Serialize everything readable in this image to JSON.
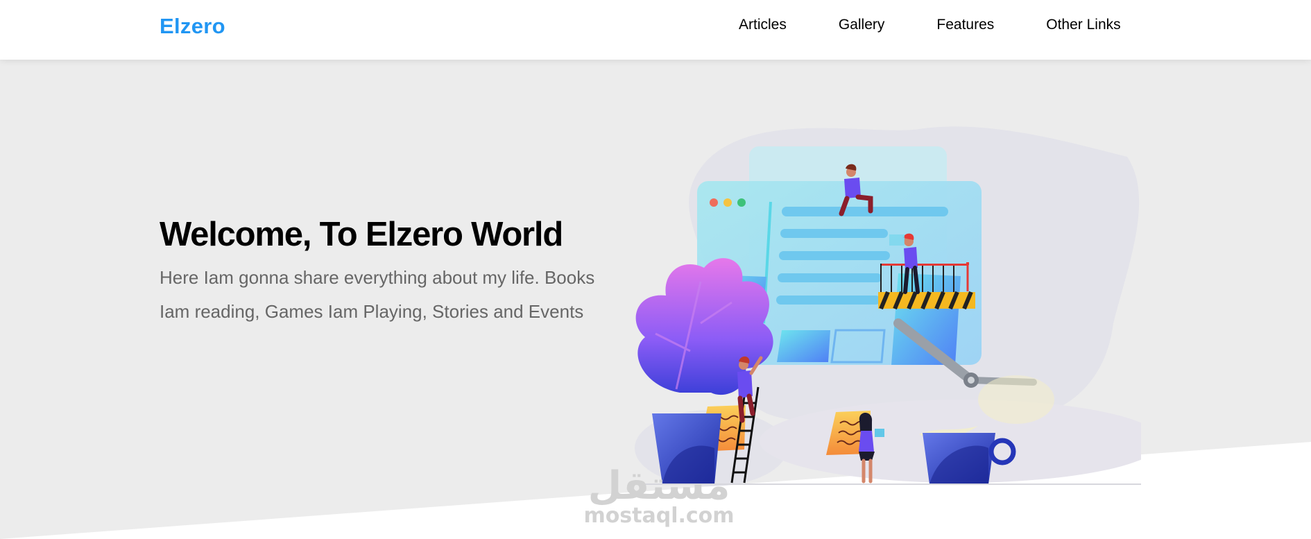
{
  "header": {
    "logo": "Elzero",
    "nav": [
      "Articles",
      "Gallery",
      "Features",
      "Other Links"
    ]
  },
  "hero": {
    "title": "Welcome, To Elzero World",
    "text": "Here Iam gonna share everything about my life. Books Iam reading, Games Iam Playing, Stories and Events"
  },
  "watermark": {
    "arabic": "مستقل",
    "latin": "mostaql.com"
  },
  "colors": {
    "brand": "#2196f3",
    "hero_bg": "#ececec",
    "header_bg": "#ffffff"
  }
}
